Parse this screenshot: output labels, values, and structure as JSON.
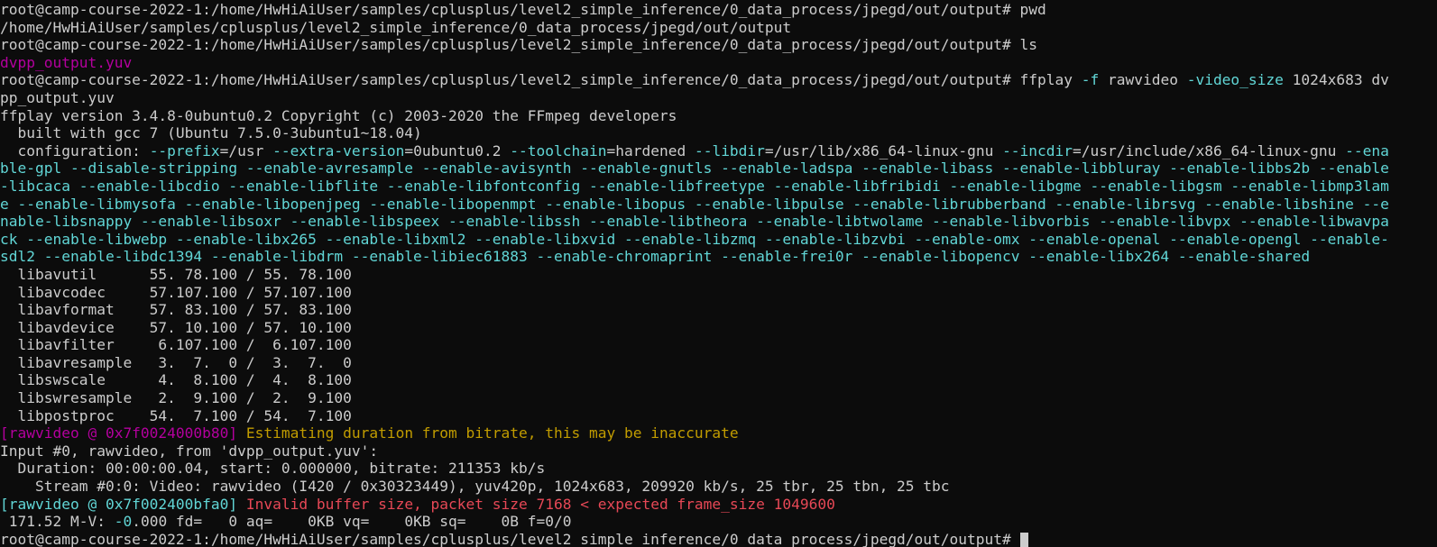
{
  "colors": {
    "default": "#cccccc",
    "cyan": "#61d6d6",
    "magenta": "#b4009e",
    "yellow": "#c19c00",
    "red": "#e74856"
  },
  "lines": [
    [
      {
        "t": "root@camp-course-2022-1:/home/HwHiAiUser/samples/cplusplus/level2_simple_inference/0_data_process/jpegd/out/output# pwd"
      }
    ],
    [
      {
        "t": "/home/HwHiAiUser/samples/cplusplus/level2_simple_inference/0_data_process/jpegd/out/output"
      }
    ],
    [
      {
        "t": "root@camp-course-2022-1:/home/HwHiAiUser/samples/cplusplus/level2_simple_inference/0_data_process/jpegd/out/output# ls"
      }
    ],
    [
      {
        "t": "dvpp_output.yuv",
        "c": "magenta"
      }
    ],
    [
      {
        "t": "root@camp-course-2022-1:/home/HwHiAiUser/samples/cplusplus/level2_simple_inference/0_data_process/jpegd/out/output# ffplay "
      },
      {
        "t": "-f",
        "c": "cyan"
      },
      {
        "t": " rawvideo "
      },
      {
        "t": "-video_size",
        "c": "cyan"
      },
      {
        "t": " 1024x683 dv"
      }
    ],
    [
      {
        "t": "pp_output.yuv"
      }
    ],
    [
      {
        "t": "ffplay version 3.4.8-0ubuntu0.2 Copyright (c) 2003-2020 the FFmpeg developers"
      }
    ],
    [
      {
        "t": "  built with gcc 7 (Ubuntu 7.5.0-3ubuntu1~18.04)"
      }
    ],
    [
      {
        "t": "  configuration: "
      },
      {
        "t": "--prefix",
        "c": "cyan"
      },
      {
        "t": "=/usr "
      },
      {
        "t": "--extra-version",
        "c": "cyan"
      },
      {
        "t": "=0ubuntu0.2 "
      },
      {
        "t": "--toolchain",
        "c": "cyan"
      },
      {
        "t": "=hardened "
      },
      {
        "t": "--libdir",
        "c": "cyan"
      },
      {
        "t": "=/usr/lib/x86_64-linux-gnu "
      },
      {
        "t": "--incdir",
        "c": "cyan"
      },
      {
        "t": "=/usr/include/x86_64-linux-gnu "
      },
      {
        "t": "--ena",
        "c": "cyan"
      }
    ],
    [
      {
        "t": "ble-gpl --disable-stripping --enable-avresample --enable-avisynth --enable-gnutls --enable-ladspa --enable-libass --enable-libbluray --enable-libbs2b --enable",
        "c": "cyan"
      }
    ],
    [
      {
        "t": "-libcaca --enable-libcdio --enable-libflite --enable-libfontconfig --enable-libfreetype --enable-libfribidi --enable-libgme --enable-libgsm --enable-libmp3lam",
        "c": "cyan"
      }
    ],
    [
      {
        "t": "e --enable-libmysofa --enable-libopenjpeg --enable-libopenmpt --enable-libopus --enable-libpulse --enable-librubberband --enable-librsvg --enable-libshine --e",
        "c": "cyan"
      }
    ],
    [
      {
        "t": "nable-libsnappy --enable-libsoxr --enable-libspeex --enable-libssh --enable-libtheora --enable-libtwolame --enable-libvorbis --enable-libvpx --enable-libwavpa",
        "c": "cyan"
      }
    ],
    [
      {
        "t": "ck --enable-libwebp --enable-libx265 --enable-libxml2 --enable-libxvid --enable-libzmq --enable-libzvbi --enable-omx --enable-openal --enable-opengl --enable-",
        "c": "cyan"
      }
    ],
    [
      {
        "t": "sdl2 --enable-libdc1394 --enable-libdrm --enable-libiec61883 --enable-chromaprint --enable-frei0r --enable-libopencv --enable-libx264 --enable-shared",
        "c": "cyan"
      }
    ],
    [
      {
        "t": "  libavutil      55. 78.100 / 55. 78.100"
      }
    ],
    [
      {
        "t": "  libavcodec     57.107.100 / 57.107.100"
      }
    ],
    [
      {
        "t": "  libavformat    57. 83.100 / 57. 83.100"
      }
    ],
    [
      {
        "t": "  libavdevice    57. 10.100 / 57. 10.100"
      }
    ],
    [
      {
        "t": "  libavfilter     6.107.100 /  6.107.100"
      }
    ],
    [
      {
        "t": "  libavresample   3.  7.  0 /  3.  7.  0"
      }
    ],
    [
      {
        "t": "  libswscale      4.  8.100 /  4.  8.100"
      }
    ],
    [
      {
        "t": "  libswresample   2.  9.100 /  2.  9.100"
      }
    ],
    [
      {
        "t": "  libpostproc    54.  7.100 / 54.  7.100"
      }
    ],
    [
      {
        "t": "[rawvideo @ 0x7f0024000b80] ",
        "c": "magenta"
      },
      {
        "t": "Estimating duration from bitrate, this may be inaccurate",
        "c": "yellow"
      }
    ],
    [
      {
        "t": "Input #0, rawvideo, from 'dvpp_output.yuv':"
      }
    ],
    [
      {
        "t": "  Duration: 00:00:00.04, start: 0.000000, bitrate: 211353 kb/s"
      }
    ],
    [
      {
        "t": "    Stream #0:0: Video: rawvideo (I420 / 0x30323449), yuv420p, 1024x683, 209920 kb/s, 25 tbr, 25 tbn, 25 tbc"
      }
    ],
    [
      {
        "t": "[rawvideo @ 0x7f002400bfa0] ",
        "c": "cyan"
      },
      {
        "t": "Invalid buffer size, packet size 7168 < expected frame_size 1049600",
        "c": "red"
      }
    ],
    [
      {
        "t": " 171.52 M-V: "
      },
      {
        "t": "-0",
        "c": "cyan"
      },
      {
        "t": ".000 fd=   0 aq=    0KB vq=    0KB sq=    0B f=0/0"
      }
    ],
    [
      {
        "t": "root@camp-course-2022-1:/home/HwHiAiUser/samples/cplusplus/level2_simple_inference/0_data_process/jpegd/out/output# "
      },
      {
        "cursor": true
      }
    ]
  ]
}
